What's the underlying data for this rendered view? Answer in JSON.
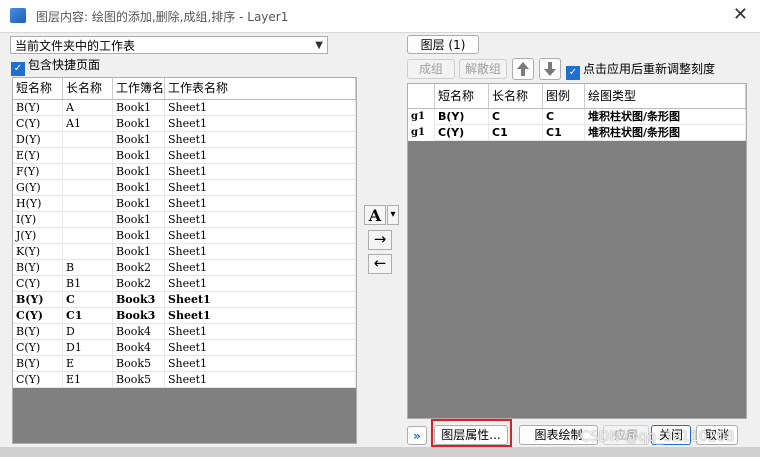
{
  "window": {
    "title": "图层内容: 绘图的添加,删除,成组,排序 - Layer1",
    "close_glyph": "✕"
  },
  "left_panel": {
    "source_dropdown": "当前文件夹中的工作表",
    "include_shortcut_label": "包含快捷页面",
    "columns": [
      "短名称",
      "长名称",
      "工作簿名",
      "工作表名称"
    ],
    "rows": [
      [
        "B(Y)",
        "A",
        "Book1",
        "Sheet1"
      ],
      [
        "C(Y)",
        "A1",
        "Book1",
        "Sheet1"
      ],
      [
        "D(Y)",
        "",
        "Book1",
        "Sheet1"
      ],
      [
        "E(Y)",
        "",
        "Book1",
        "Sheet1"
      ],
      [
        "F(Y)",
        "",
        "Book1",
        "Sheet1"
      ],
      [
        "G(Y)",
        "",
        "Book1",
        "Sheet1"
      ],
      [
        "H(Y)",
        "",
        "Book1",
        "Sheet1"
      ],
      [
        "I(Y)",
        "",
        "Book1",
        "Sheet1"
      ],
      [
        "J(Y)",
        "",
        "Book1",
        "Sheet1"
      ],
      [
        "K(Y)",
        "",
        "Book1",
        "Sheet1"
      ],
      [
        "B(Y)",
        "B",
        "Book2",
        "Sheet1"
      ],
      [
        "C(Y)",
        "B1",
        "Book2",
        "Sheet1"
      ],
      [
        "B(Y)",
        "C",
        "Book3",
        "Sheet1"
      ],
      [
        "C(Y)",
        "C1",
        "Book3",
        "Sheet1"
      ],
      [
        "B(Y)",
        "D",
        "Book4",
        "Sheet1"
      ],
      [
        "C(Y)",
        "D1",
        "Book4",
        "Sheet1"
      ],
      [
        "B(Y)",
        "E",
        "Book5",
        "Sheet1"
      ],
      [
        "C(Y)",
        "E1",
        "Book5",
        "Sheet1"
      ]
    ]
  },
  "middle": {
    "font_button": "A",
    "dropdown_glyph": "▾",
    "add_arrow": "→",
    "remove_arrow": "←"
  },
  "right_panel": {
    "layer_button": "图层 (1)",
    "group_button": "成组",
    "ungroup_button": "解散组",
    "rescale_label": "点击应用后重新调整刻度",
    "columns": [
      "",
      "短名称",
      "长名称",
      "图例",
      "绘图类型"
    ],
    "rows": [
      [
        "g1",
        "B(Y)",
        "C",
        "C",
        "堆积柱状图/条形图"
      ],
      [
        "g1",
        "C(Y)",
        "C1",
        "C1",
        "堆积柱状图/条形图"
      ]
    ]
  },
  "footer": {
    "expand": "»",
    "layer_props": "图层属性...",
    "plot_button": "图表绘制",
    "apply": "应用",
    "close": "关闭",
    "cancel": "取消"
  },
  "watermark": "CSDN @qq_38110208",
  "colors": {
    "accent": "#1f6fd1",
    "highlight": "#e02020",
    "table_bg": "#808080"
  }
}
